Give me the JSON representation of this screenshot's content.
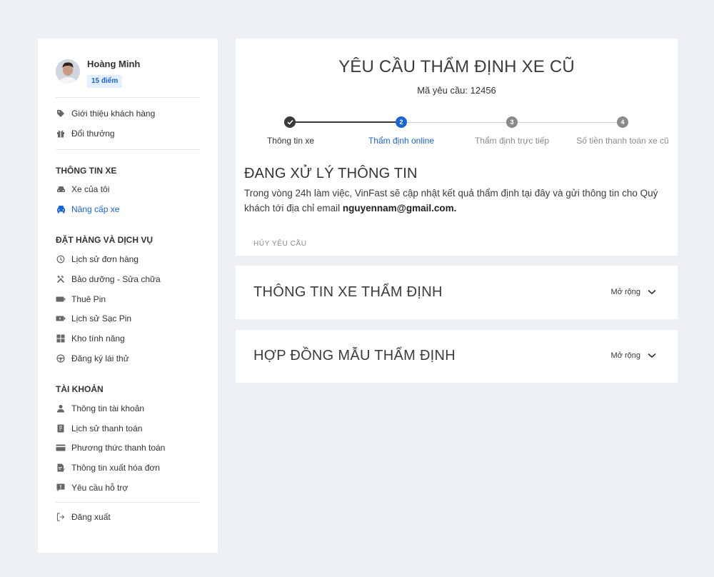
{
  "user": {
    "name": "Hoàng Minh",
    "points": "15 điểm"
  },
  "sidebar": {
    "top_links": [
      {
        "label": "Giới thiệu khách hàng",
        "icon": "tag-icon"
      },
      {
        "label": "Đổi thưởng",
        "icon": "gift-icon"
      }
    ],
    "sections": [
      {
        "title": "THÔNG TIN XE",
        "items": [
          {
            "label": "Xe của tôi",
            "icon": "car-icon",
            "active": false
          },
          {
            "label": "Nâng cấp xe",
            "icon": "car-front-icon",
            "active": true
          }
        ]
      },
      {
        "title": "ĐẶT HÀNG VÀ DỊCH VỤ",
        "items": [
          {
            "label": "Lịch sử đơn hàng",
            "icon": "history-icon"
          },
          {
            "label": "Bảo dưỡng - Sửa chữa",
            "icon": "tools-icon"
          },
          {
            "label": "Thuê Pin",
            "icon": "battery-icon"
          },
          {
            "label": "Lịch sử Sạc Pin",
            "icon": "charging-icon"
          },
          {
            "label": "Kho tính năng",
            "icon": "grid-icon"
          },
          {
            "label": "Đăng ký lái thử",
            "icon": "steering-wheel-icon"
          }
        ]
      },
      {
        "title": "TÀI KHOẢN",
        "items": [
          {
            "label": "Thông tin tài khoản",
            "icon": "user-icon"
          },
          {
            "label": "Lịch sử thanh toán",
            "icon": "receipt-icon"
          },
          {
            "label": "Phương thức thanh toán",
            "icon": "credit-card-icon"
          },
          {
            "label": "Thông tin xuất hóa đơn",
            "icon": "invoice-icon"
          },
          {
            "label": "Yêu cầu hỗ trợ",
            "icon": "support-icon"
          }
        ]
      }
    ],
    "logout": {
      "label": "Đăng xuất",
      "icon": "logout-icon"
    }
  },
  "request": {
    "title": "YÊU CẦU THẨM ĐỊNH XE CŨ",
    "id_text": "Mã yêu cầu: 12456",
    "steps": [
      {
        "label": "Thông tin xe",
        "number": "",
        "state": "done"
      },
      {
        "label": "Thẩm định online",
        "number": "2",
        "state": "current"
      },
      {
        "label": "Thẩm định trực tiếp",
        "number": "3",
        "state": "todo"
      },
      {
        "label": "Số tiền thanh toán xe cũ",
        "number": "4",
        "state": "todo"
      }
    ],
    "status_title": "ĐANG XỬ LÝ THÔNG TIN",
    "status_desc": "Trong vòng 24h làm việc, VinFast sẽ cập nhật kết quả thẩm định tại đây và gửi thông tin cho Quý khách tới địa chỉ email ",
    "email": "nguyennam@gmail.com.",
    "cancel_label": "HỦY YÊU CẦU"
  },
  "accordions": [
    {
      "title": "THÔNG TIN XE THẨM ĐỊNH",
      "toggle": "Mở rộng"
    },
    {
      "title": "HỢP ĐỒNG MẪU THẨM ĐỊNH",
      "toggle": "Mở rộng"
    }
  ],
  "colors": {
    "accent": "#1a64d6",
    "done": "#3a3a3a",
    "todo": "#8a8a8a",
    "background": "#eef1f4"
  }
}
